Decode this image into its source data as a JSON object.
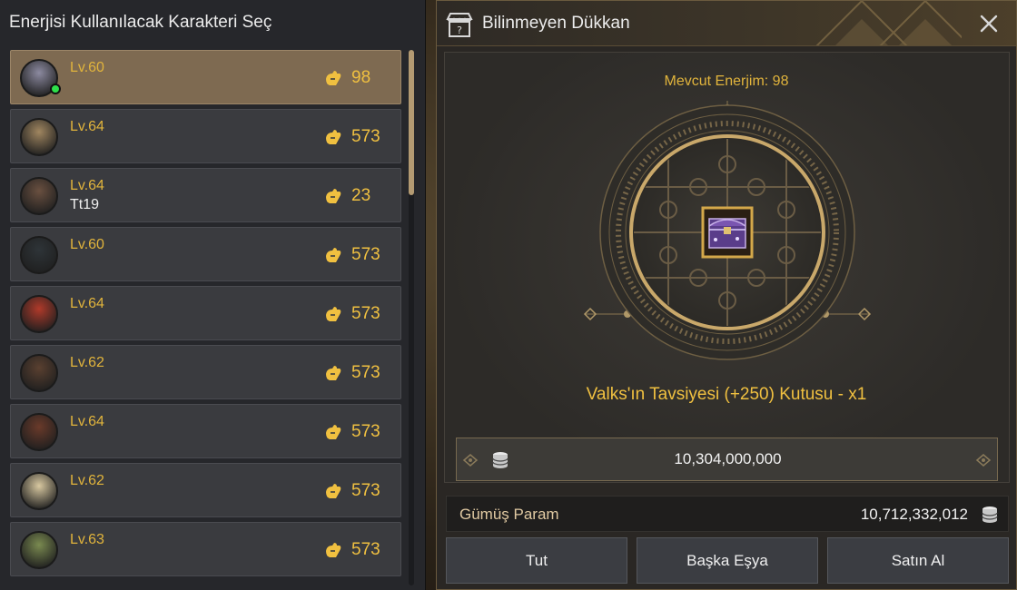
{
  "left": {
    "title": "Enerjisi Kullanılacak Karakteri Seç",
    "characters": [
      {
        "level": "Lv.60",
        "name": "",
        "energy": "98",
        "selected": true,
        "online": true,
        "avatar_color": "#8c8aa0"
      },
      {
        "level": "Lv.64",
        "name": "",
        "energy": "573",
        "selected": false,
        "online": false,
        "avatar_color": "#a08660"
      },
      {
        "level": "Lv.64",
        "name": "Tt19",
        "energy": "23",
        "selected": false,
        "online": false,
        "avatar_color": "#6a5040"
      },
      {
        "level": "Lv.60",
        "name": "",
        "energy": "573",
        "selected": false,
        "online": false,
        "avatar_color": "#2e3438"
      },
      {
        "level": "Lv.64",
        "name": "",
        "energy": "573",
        "selected": false,
        "online": false,
        "avatar_color": "#b03a2a"
      },
      {
        "level": "Lv.62",
        "name": "",
        "energy": "573",
        "selected": false,
        "online": false,
        "avatar_color": "#5a4030"
      },
      {
        "level": "Lv.64",
        "name": "",
        "energy": "573",
        "selected": false,
        "online": false,
        "avatar_color": "#6a3a2a"
      },
      {
        "level": "Lv.62",
        "name": "",
        "energy": "573",
        "selected": false,
        "online": false,
        "avatar_color": "#d8c8a0"
      },
      {
        "level": "Lv.63",
        "name": "",
        "energy": "573",
        "selected": false,
        "online": false,
        "avatar_color": "#7a8a50"
      }
    ]
  },
  "shop": {
    "title": "Bilinmeyen Dükkan",
    "energy_label": "Mevcut Enerjim: 98",
    "item_name": "Valks'ın Tavsiyesi (+250) Kutusu - x1",
    "price": "10,304,000,000",
    "silver_label": "Gümüş Param",
    "silver_value": "10,712,332,012",
    "buttons": {
      "keep": "Tut",
      "other": "Başka Eşya",
      "buy": "Satın Al"
    }
  },
  "colors": {
    "gold": "#f0c040",
    "selected_row": "#7e6a51",
    "online": "#2ee04a"
  },
  "icons": [
    "energy-icon",
    "shop-icon",
    "close-icon",
    "silver-coin-icon",
    "treasure-chest-icon"
  ]
}
